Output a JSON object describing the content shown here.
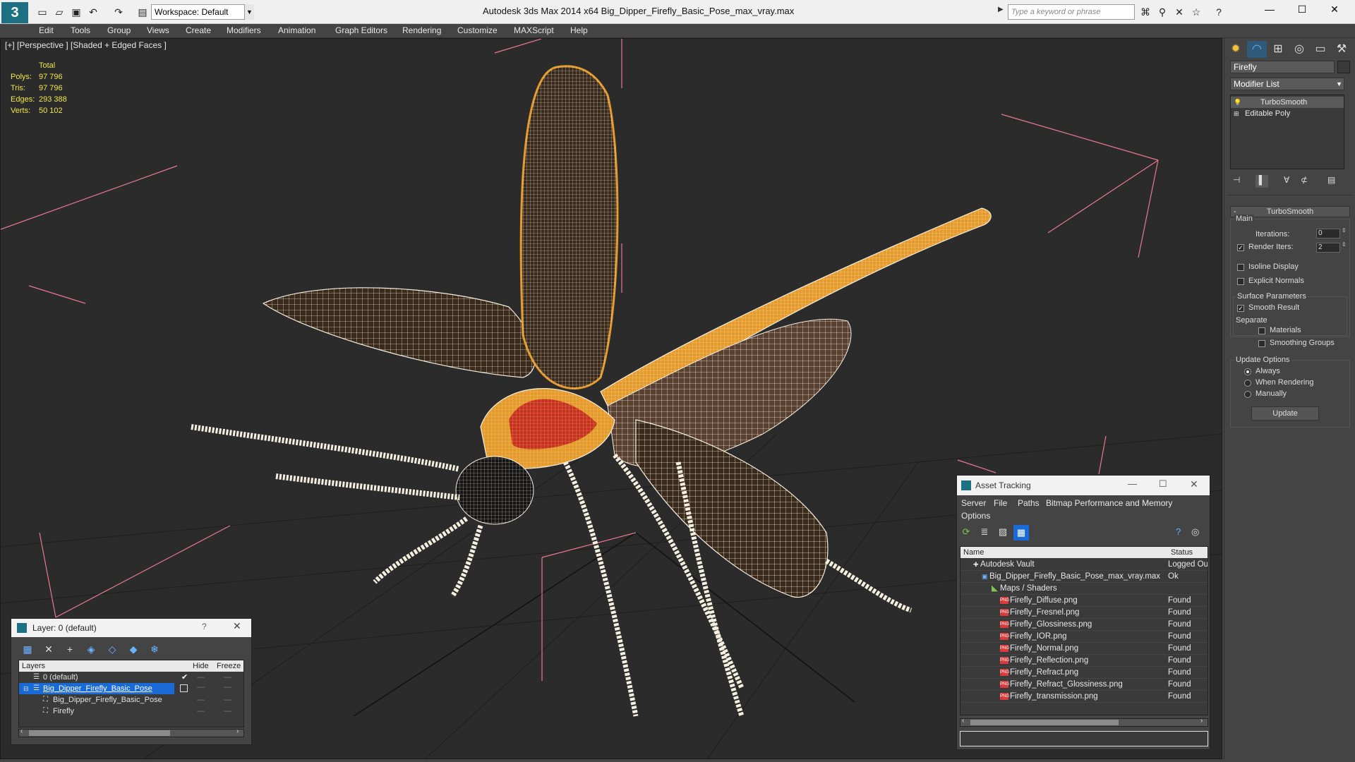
{
  "app": {
    "title": "Autodesk 3ds Max  2014 x64     Big_Dipper_Firefly_Basic_Pose_max_vray.max",
    "workspace": "Workspace: Default",
    "search_placeholder": "Type a keyword or phrase"
  },
  "menu": [
    "Edit",
    "Tools",
    "Group",
    "Views",
    "Create",
    "Modifiers",
    "Animation",
    "Graph Editors",
    "Rendering",
    "Customize",
    "MAXScript",
    "Help"
  ],
  "viewport": {
    "label": "[+] [Perspective ] [Shaded + Edged Faces ]",
    "stats": {
      "header": "Total",
      "rows": [
        {
          "label": "Polys:",
          "value": "97 796"
        },
        {
          "label": "Tris:",
          "value": "97 796"
        },
        {
          "label": "Edges:",
          "value": "293 388"
        },
        {
          "label": "Verts:",
          "value": "50 102"
        }
      ]
    }
  },
  "command_panel": {
    "object_name": "Firefly",
    "modifier_list": "Modifier List",
    "stack": [
      "TurboSmooth",
      "Editable Poly"
    ],
    "rollout_title": "TurboSmooth",
    "main_label": "Main",
    "iterations_label": "Iterations:",
    "iterations_value": "0",
    "render_iters_label": "Render Iters:",
    "render_iters_value": "2",
    "isoline_label": "Isoline Display",
    "explicit_label": "Explicit Normals",
    "surface_label": "Surface Parameters",
    "smooth_result_label": "Smooth Result",
    "separate_label": "Separate",
    "materials_label": "Materials",
    "smoothing_groups_label": "Smoothing Groups",
    "update_options_label": "Update Options",
    "always_label": "Always",
    "when_rendering_label": "When Rendering",
    "manually_label": "Manually",
    "update_button": "Update"
  },
  "layer_dialog": {
    "title": "Layer: 0 (default)",
    "help": "?",
    "columns": [
      "Layers",
      "Hide",
      "Freeze"
    ],
    "rows": [
      {
        "name": "0 (default)",
        "hide": "—",
        "freeze": "—"
      },
      {
        "name": "Big_Dipper_Firefly_Basic_Pose",
        "hide": "—",
        "freeze": "—"
      },
      {
        "name": "Big_Dipper_Firefly_Basic_Pose",
        "hide": "—",
        "freeze": "—"
      },
      {
        "name": "Firefly",
        "hide": "—",
        "freeze": "—"
      }
    ]
  },
  "asset_dialog": {
    "title": "Asset Tracking",
    "menus": [
      "Server",
      "File",
      "Paths",
      "Bitmap Performance and Memory",
      "Options"
    ],
    "columns": [
      "Name",
      "Status"
    ],
    "rows": [
      {
        "name": "Autodesk Vault",
        "status": "Logged Ou"
      },
      {
        "name": "Big_Dipper_Firefly_Basic_Pose_max_vray.max",
        "status": "Ok"
      },
      {
        "name": "Maps / Shaders",
        "status": ""
      },
      {
        "name": "Firefly_Diffuse.png",
        "status": "Found"
      },
      {
        "name": "Firefly_Fresnel.png",
        "status": "Found"
      },
      {
        "name": "Firefly_Glossiness.png",
        "status": "Found"
      },
      {
        "name": "Firefly_IOR.png",
        "status": "Found"
      },
      {
        "name": "Firefly_Normal.png",
        "status": "Found"
      },
      {
        "name": "Firefly_Reflection.png",
        "status": "Found"
      },
      {
        "name": "Firefly_Refract.png",
        "status": "Found"
      },
      {
        "name": "Firefly_Refract_Glossiness.png",
        "status": "Found"
      },
      {
        "name": "Firefly_transmission.png",
        "status": "Found"
      }
    ]
  },
  "colors": {
    "viewport_bg": "#2b2b2b",
    "stats_text": "#f2e64a",
    "selection": "#1a6ad6",
    "wire": "#f5efe0",
    "wing": "#3a2a1c",
    "orange": "#e59a2a"
  }
}
